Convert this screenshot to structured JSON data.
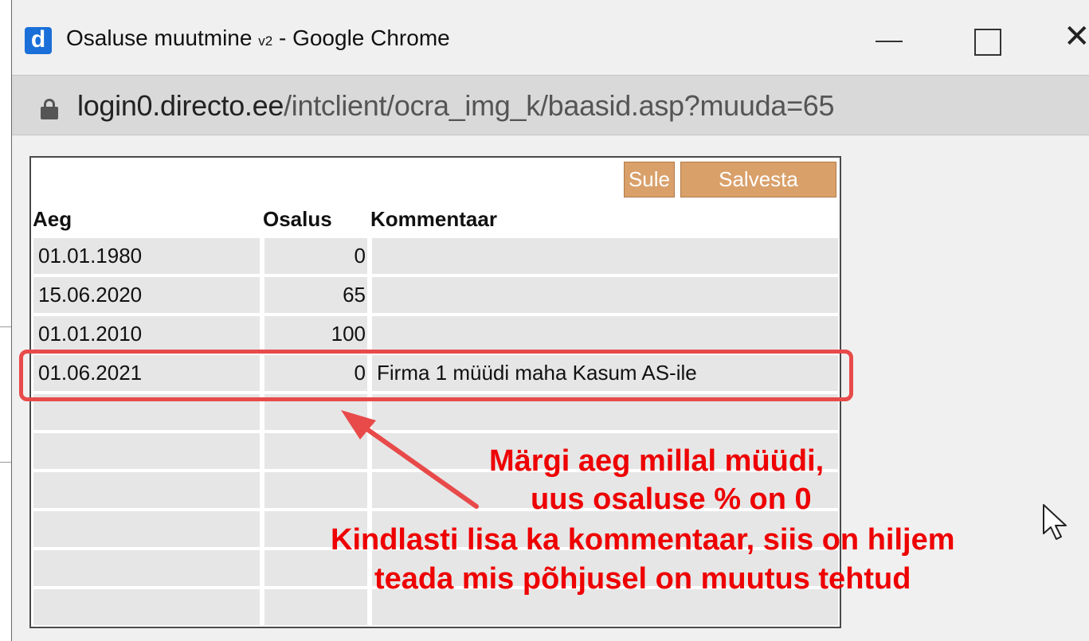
{
  "window": {
    "title": "Osaluse muutmine",
    "title_suffix": "v2",
    "title_app": " - Google Chrome",
    "app_icon_letter": "d",
    "close_glyph": "✕"
  },
  "address": {
    "host": "login0.directo.ee",
    "path": "/intclient/ocra_img_k/baasid.asp?muuda=65"
  },
  "buttons": {
    "sule": "Sule",
    "salvesta": "Salvesta"
  },
  "table": {
    "headers": [
      "Aeg",
      "Osalus",
      "Kommentaar"
    ],
    "rows": [
      {
        "aeg": "01.01.1980",
        "osalus": "0",
        "kommentaar": ""
      },
      {
        "aeg": "15.06.2020",
        "osalus": "65",
        "kommentaar": ""
      },
      {
        "aeg": "01.01.2010",
        "osalus": "100",
        "kommentaar": ""
      },
      {
        "aeg": "01.06.2021",
        "osalus": "0",
        "kommentaar": "Firma 1 müüdi maha Kasum AS-ile"
      },
      {
        "aeg": "",
        "osalus": "",
        "kommentaar": ""
      },
      {
        "aeg": "",
        "osalus": "",
        "kommentaar": ""
      },
      {
        "aeg": "",
        "osalus": "",
        "kommentaar": ""
      },
      {
        "aeg": "",
        "osalus": "",
        "kommentaar": ""
      },
      {
        "aeg": "",
        "osalus": "",
        "kommentaar": ""
      },
      {
        "aeg": "",
        "osalus": "",
        "kommentaar": ""
      }
    ]
  },
  "annotation": {
    "line1": "Märgi aeg millal müüdi,",
    "line2": "uus osaluse % on 0",
    "line3": "Kindlasti lisa ka kommentaar, siis on hiljem",
    "line4": "teada mis põhjusel on muutus tehtud",
    "color": "#ee0000"
  },
  "colors": {
    "button_bg": "#d9a06a",
    "highlight": "#e84a4a",
    "cell_bg": "#e6e6e6"
  }
}
